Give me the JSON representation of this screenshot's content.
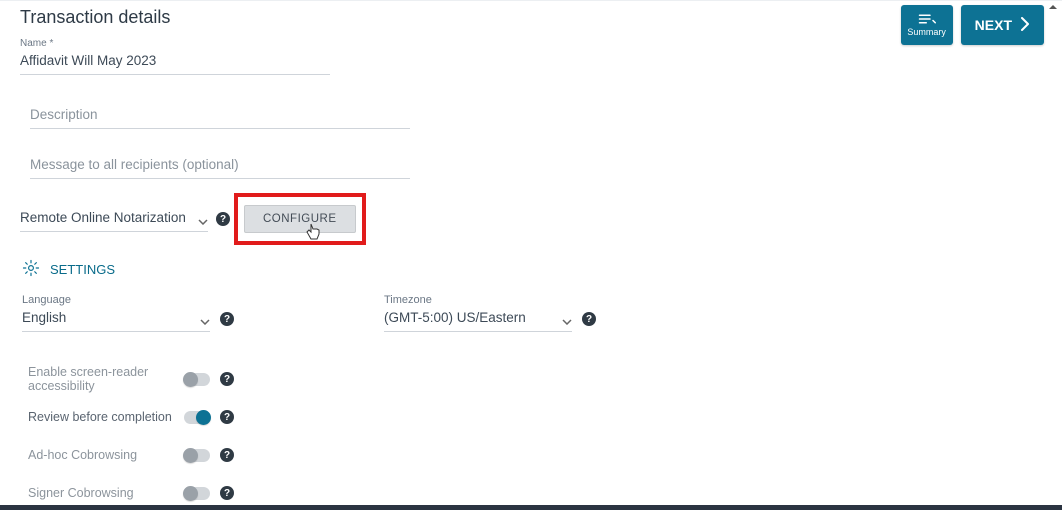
{
  "header": {
    "summary_label": "Summary",
    "next_label": "NEXT"
  },
  "section_title": "Transaction details",
  "name_field": {
    "label": "Name *",
    "value": "Affidavit Will May 2023"
  },
  "description_field": {
    "placeholder": "Description",
    "value": ""
  },
  "message_field": {
    "placeholder": "Message to all recipients (optional)",
    "value": ""
  },
  "notary": {
    "selected": "Remote Online Notarization",
    "configure_label": "CONFIGURE"
  },
  "settings": {
    "link_label": "SETTINGS",
    "language": {
      "label": "Language",
      "value": "English"
    },
    "timezone": {
      "label": "Timezone",
      "value": "(GMT-5:00) US/Eastern"
    }
  },
  "toggles": {
    "accessibility": {
      "label": "Enable screen-reader accessibility",
      "on": false
    },
    "review": {
      "label": "Review before completion",
      "on": true
    },
    "adhoc": {
      "label": "Ad-hoc Cobrowsing",
      "on": false
    },
    "signer": {
      "label": "Signer Cobrowsing",
      "on": false
    }
  }
}
